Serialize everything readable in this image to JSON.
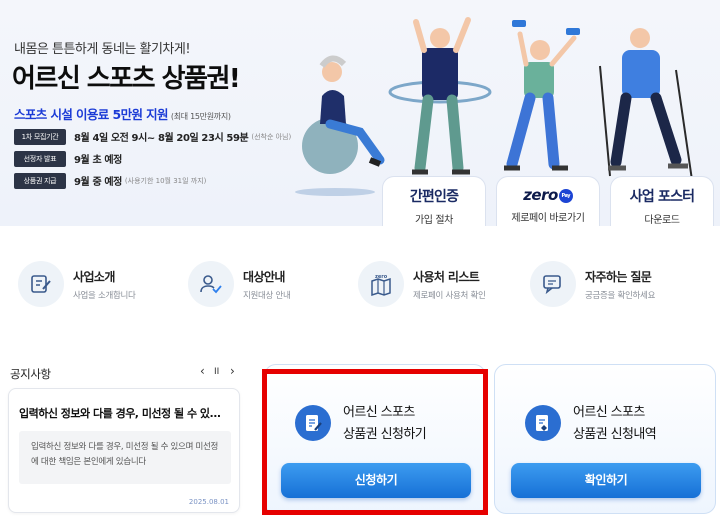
{
  "hero": {
    "subtitle": "내몸은 튼튼하게 동네는 활기차게!",
    "title": "어르신 스포츠 상품권!",
    "support_prefix": "스포츠 시설 이용료 ",
    "support_amount": "5만원 지원",
    "support_note": "(최대 15만원까지)",
    "schedule": [
      {
        "tag": "1차 모집기간",
        "value": "8월 4일 오전 9시~ 8월 20일 23시 59분",
        "note": "(선착순 아님)"
      },
      {
        "tag": "선정자 발표",
        "value": "9월 초 예정",
        "note": ""
      },
      {
        "tag": "상품권 지급",
        "value": "9월 중 예정",
        "note": "(사용기한 10월 31일 까지)"
      }
    ]
  },
  "quick_links": [
    {
      "heading": "간편인증",
      "label": "가입 절차"
    },
    {
      "heading_logo": "zero",
      "heading_badge": "Pay",
      "label": "제로페이 바로가기"
    },
    {
      "heading": "사업 포스터",
      "label": "다운로드"
    }
  ],
  "menu": [
    {
      "title": "사업소개",
      "desc": "사업을 소개합니다",
      "icon": "edit-doc-icon"
    },
    {
      "title": "대상안내",
      "desc": "지원대상 안내",
      "icon": "user-check-icon"
    },
    {
      "title": "사용처 리스트",
      "desc": "제로페이 사용처 확인",
      "icon": "map-icon",
      "icon_label": "zero"
    },
    {
      "title": "자주하는 질문",
      "desc": "궁금증을 확인하세요",
      "icon": "chat-icon"
    }
  ],
  "notice": {
    "heading": "공지사항",
    "prev": "‹",
    "pause": "II",
    "next": "›",
    "item_title": "입력하신 정보와 다를 경우, 미선정 될 수 있...",
    "item_body": "입력하신 정보와 다를 경우, 미선정 될 수 있으며 미선정에 대한 책임은 본인에게 있습니다",
    "item_date": "2025.08.01"
  },
  "apply_card": {
    "line1": "어르신 스포츠",
    "line2": "상품권 신청하기",
    "button": "신청하기"
  },
  "history_card": {
    "line1": "어르신 스포츠",
    "line2": "상품권 신청내역",
    "button": "확인하기"
  },
  "colors": {
    "accent_blue": "#1b3bd6",
    "button_blue": "#1670d6",
    "highlight_green": "#9ef08a",
    "red_frame": "#e60000"
  }
}
